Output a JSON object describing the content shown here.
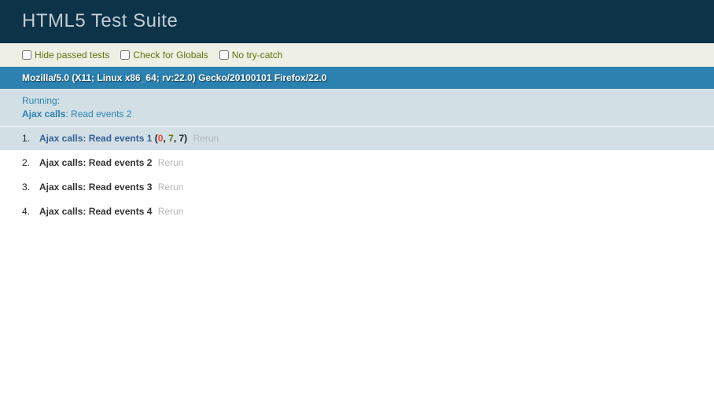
{
  "header": {
    "title": "HTML5 Test Suite"
  },
  "toolbar": {
    "hide_passed": {
      "label": "Hide passed tests",
      "checked": false
    },
    "check_globals": {
      "label": "Check for Globals",
      "checked": false
    },
    "no_trycatch": {
      "label": "No try-catch",
      "checked": false
    }
  },
  "useragent": "Mozilla/5.0 (X11; Linux x86_64; rv:22.0) Gecko/20100101 Firefox/22.0",
  "testresult": {
    "running_label": "Running:",
    "module": "Ajax calls",
    "test": "Read events 2"
  },
  "tests": [
    {
      "num": "1.",
      "module": "Ajax calls:",
      "name": "Read events 1",
      "counts": {
        "failed": "0",
        "passed": "7",
        "total": "7"
      },
      "rerun": "Rerun",
      "state": "current"
    },
    {
      "num": "2.",
      "module": "Ajax calls:",
      "name": "Read events 2",
      "rerun": "Rerun",
      "state": "running"
    },
    {
      "num": "3.",
      "module": "Ajax calls:",
      "name": "Read events 3",
      "rerun": "Rerun",
      "state": "running"
    },
    {
      "num": "4.",
      "module": "Ajax calls:",
      "name": "Read events 4",
      "rerun": "Rerun",
      "state": "running"
    }
  ]
}
